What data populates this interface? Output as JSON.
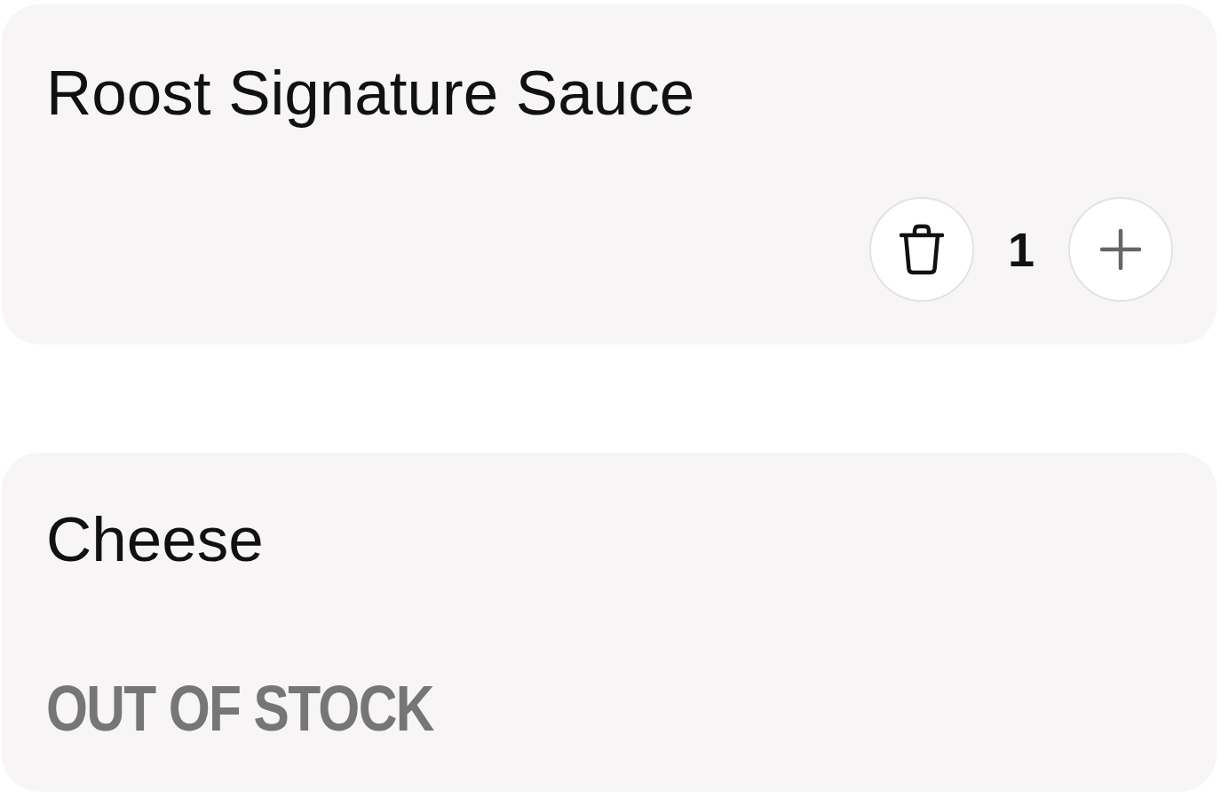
{
  "items": [
    {
      "kind": "in_stock",
      "name": "Roost Signature Sauce",
      "quantity": "1"
    },
    {
      "kind": "out_of_stock",
      "name": "Cheese",
      "status": "OUT OF STOCK"
    }
  ]
}
